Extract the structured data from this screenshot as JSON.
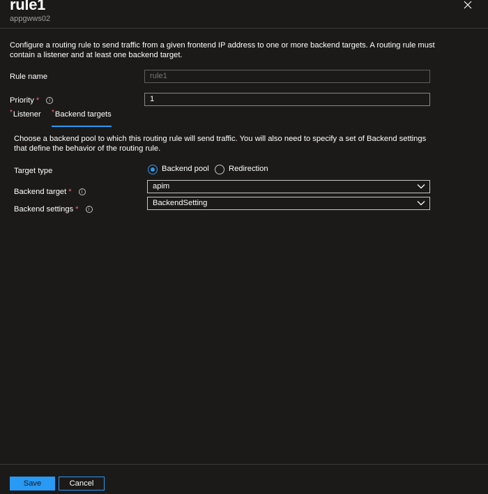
{
  "blade": {
    "title": "rule1",
    "subtitle": "appgwws02",
    "close_icon": "close-icon"
  },
  "description": "Configure a routing rule to send traffic from a given frontend IP address to one or more backend targets. A routing rule must contain a listener and at least one backend target.",
  "form": {
    "rule_name": {
      "label": "Rule name",
      "value": "rule1"
    },
    "priority": {
      "label": "Priority",
      "required_mark": "*",
      "value": "1"
    }
  },
  "tabs": [
    {
      "label": "Listener",
      "required_mark": "*",
      "active": false
    },
    {
      "label": "Backend targets",
      "required_mark": "*",
      "active": true
    }
  ],
  "backend": {
    "description": "Choose a backend pool to which this routing rule will send traffic. You will also need to specify a set of Backend settings that define the behavior of the routing rule.",
    "target_type": {
      "label": "Target type",
      "options": [
        {
          "label": "Backend pool",
          "selected": true
        },
        {
          "label": "Redirection",
          "selected": false
        }
      ]
    },
    "backend_target": {
      "label": "Backend target",
      "required_mark": "*",
      "value": "apim"
    },
    "backend_settings": {
      "label": "Backend settings",
      "required_mark": "*",
      "value": "BackendSetting"
    }
  },
  "footer": {
    "save_label": "Save",
    "cancel_label": "Cancel"
  },
  "colors": {
    "background": "#1b1a19",
    "accent": "#2899f5",
    "required": "#f1707b",
    "muted_text": "#a19f9d"
  }
}
